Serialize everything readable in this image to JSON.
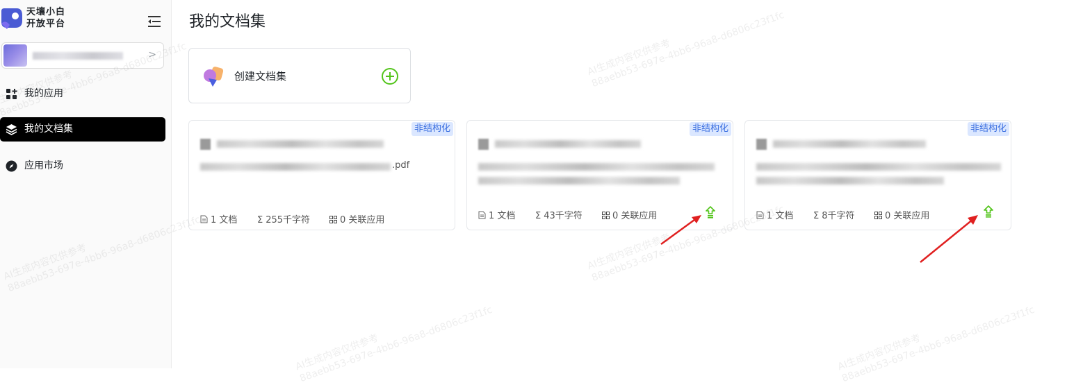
{
  "brand": {
    "name_line1": "天壤小白",
    "name_line2": "开放平台"
  },
  "nav": {
    "items": [
      {
        "label": "我的应用",
        "icon": "apps-grid-icon"
      },
      {
        "label": "我的文档集",
        "icon": "layers-icon",
        "active": true
      },
      {
        "label": "应用市场",
        "icon": "compass-icon"
      }
    ]
  },
  "main": {
    "title": "我的文档集",
    "create_label": "创建文档集"
  },
  "cards": [
    {
      "tag": "非结构化",
      "file_suffix": ".pdf",
      "docs": "1 文档",
      "chars": "255千字符",
      "apps": "0 关联应用",
      "has_upload": false
    },
    {
      "tag": "非结构化",
      "docs": "1 文档",
      "chars": "43千字符",
      "apps": "0 关联应用",
      "has_upload": true
    },
    {
      "tag": "非结构化",
      "docs": "1 文档",
      "chars": "8千字符",
      "apps": "0 关联应用",
      "has_upload": true
    }
  ],
  "watermark": {
    "line1": "AI生成内容仅供参考",
    "line2": "88aebb53-697e-4bb6-96a8-d6806c23f1fc"
  },
  "colors": {
    "accent_green": "#52c41a",
    "tag_bg": "#dbe7ff",
    "tag_text": "#3b6fe0",
    "annotation_arrow": "#e02020"
  }
}
